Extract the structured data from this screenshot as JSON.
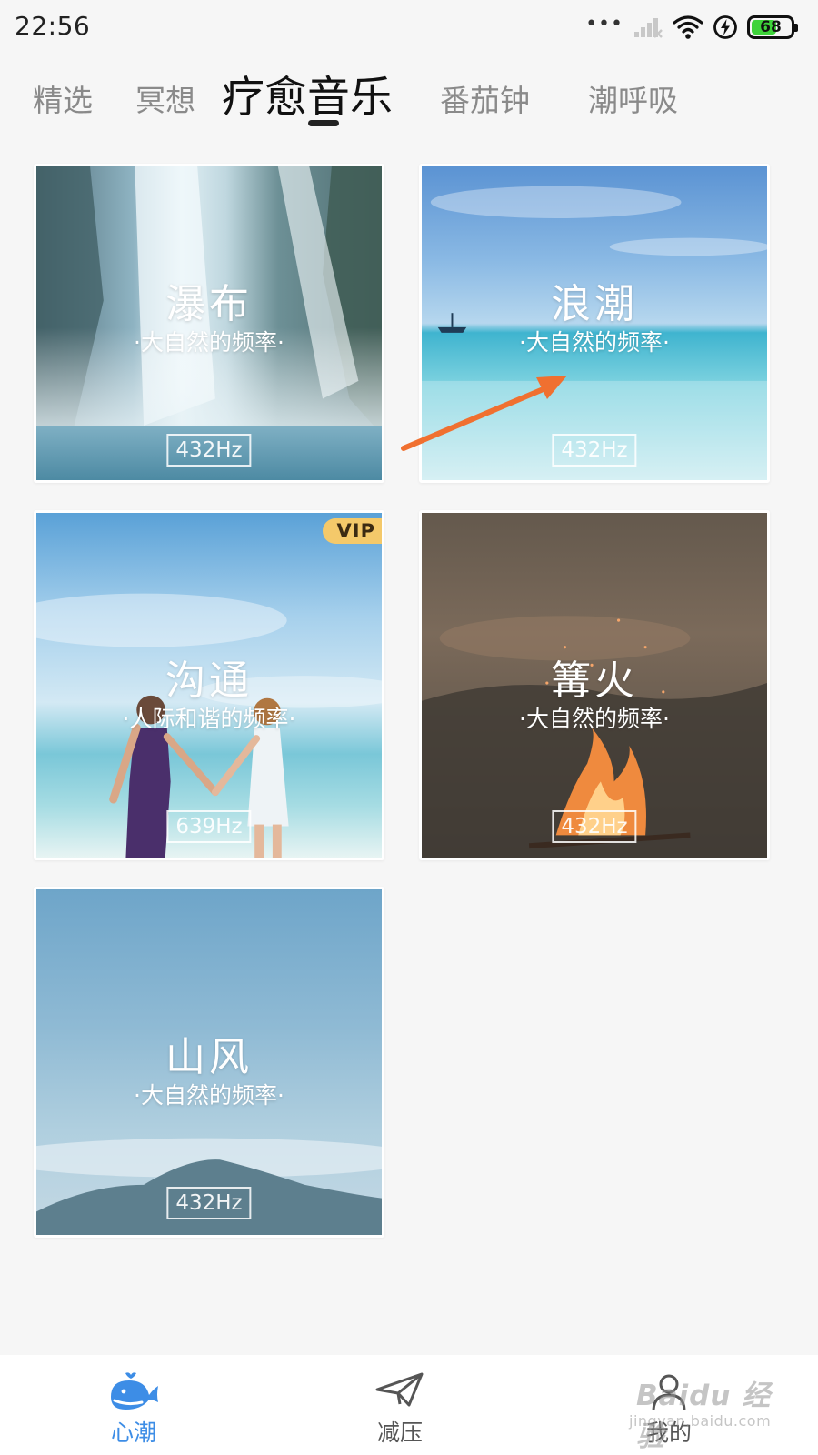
{
  "status_bar": {
    "time": "22:56",
    "battery_level": 68,
    "battery_text": "68",
    "icons": [
      "more-dots-icon",
      "signal-icon",
      "wifi-icon",
      "charging-icon",
      "battery-icon"
    ]
  },
  "tabs": [
    {
      "label": "精选",
      "active": false
    },
    {
      "label": "冥想",
      "active": false
    },
    {
      "label": "疗愈音乐",
      "active": true
    },
    {
      "label": "番茄钟",
      "active": false
    },
    {
      "label": "潮呼吸",
      "active": false
    }
  ],
  "cards": [
    {
      "title": "瀑布",
      "subtitle": "·大自然的频率·",
      "frequency": "432Hz",
      "vip": false,
      "icon": "waterfall-image"
    },
    {
      "title": "浪潮",
      "subtitle": "·大自然的频率·",
      "frequency": "432Hz",
      "vip": false,
      "icon": "ocean-image"
    },
    {
      "title": "沟通",
      "subtitle": "·人际和谐的频率·",
      "frequency": "639Hz",
      "vip": true,
      "vip_label": "VIP",
      "icon": "beach-couple-image"
    },
    {
      "title": "篝火",
      "subtitle": "·大自然的频率·",
      "frequency": "432Hz",
      "vip": false,
      "icon": "campfire-image"
    },
    {
      "title": "山风",
      "subtitle": "·大自然的频率·",
      "frequency": "432Hz",
      "vip": false,
      "icon": "mountain-image"
    }
  ],
  "bottom_nav": [
    {
      "label": "心潮",
      "active": true,
      "icon": "whale-icon"
    },
    {
      "label": "减压",
      "active": false,
      "icon": "paper-plane-icon"
    },
    {
      "label": "我的",
      "active": false,
      "icon": "profile-icon"
    }
  ],
  "watermark": {
    "main": "Baidu 经验",
    "sub": "jingyan.baidu.com"
  },
  "colors": {
    "background": "#f6f6f6",
    "accent_blue": "#3d8de6",
    "vip_gold": "#f4c96a",
    "annotation_arrow": "#f07030",
    "battery_green": "#3ed33a"
  }
}
